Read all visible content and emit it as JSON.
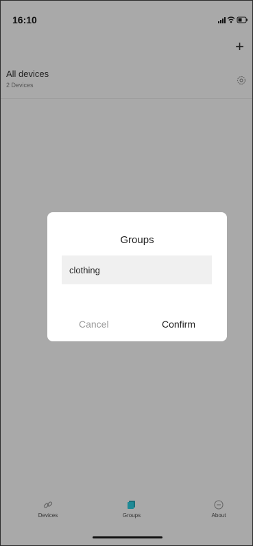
{
  "status_bar": {
    "time": "16:10"
  },
  "header": {
    "add_label": "+"
  },
  "devices_row": {
    "title": "All devices",
    "subtitle": "2 Devices"
  },
  "dialog": {
    "title": "Groups",
    "input_value": "clothing",
    "cancel_label": "Cancel",
    "confirm_label": "Confirm"
  },
  "tab_bar": {
    "items": [
      {
        "label": "Devices",
        "icon": "link-icon"
      },
      {
        "label": "Groups",
        "icon": "groups-icon",
        "active": true
      },
      {
        "label": "About",
        "icon": "info-circle-icon"
      }
    ]
  },
  "colors": {
    "accent": "#1f8a96",
    "overlay": "#a9a9a9",
    "dialog": "#ffffff",
    "cancel_text": "#9a9a9a"
  }
}
